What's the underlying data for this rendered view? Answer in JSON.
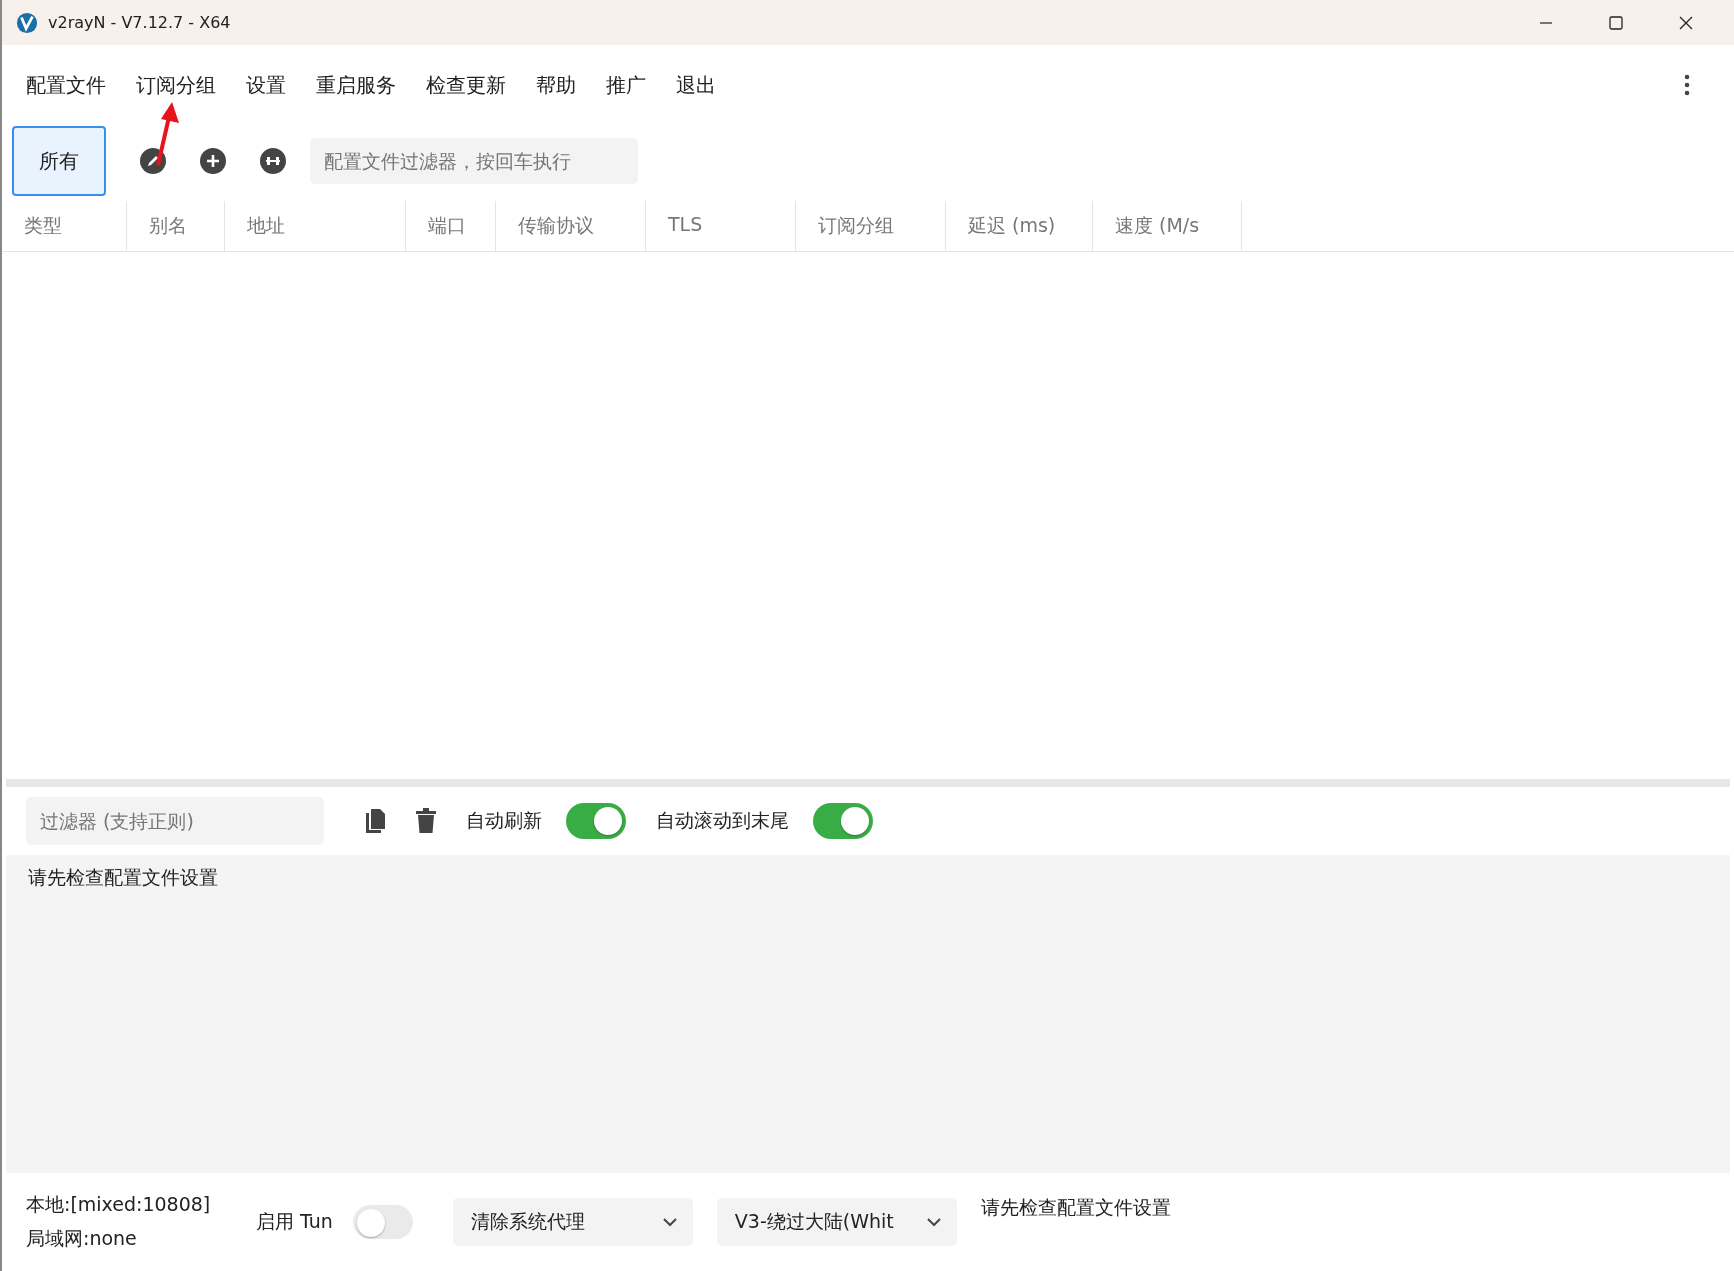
{
  "window": {
    "title": "v2rayN - V7.12.7 - X64"
  },
  "menu": [
    "配置文件",
    "订阅分组",
    "设置",
    "重启服务",
    "检查更新",
    "帮助",
    "推广",
    "退出"
  ],
  "groups": [
    {
      "label": "所有",
      "selected": true
    }
  ],
  "profile_filter": {
    "placeholder": "配置文件过滤器，按回车执行"
  },
  "table": {
    "columns": [
      "类型",
      "别名",
      "地址",
      "端口",
      "传输协议",
      "TLS",
      "订阅分组",
      "延迟 (ms)",
      "速度 (M/s"
    ]
  },
  "log_toolbar": {
    "filter": {
      "placeholder": "过滤器 (支持正则)"
    },
    "toggles": [
      {
        "label": "自动刷新",
        "on": true
      },
      {
        "label": "自动滚动到末尾",
        "on": true
      }
    ]
  },
  "log": {
    "lines": [
      "请先检查配置文件设置"
    ]
  },
  "status_bar": {
    "local": "本地:[mixed:10808]",
    "lan": "局域网:none",
    "tun": {
      "label": "启用 Tun",
      "on": false
    },
    "selects": [
      {
        "value": "清除系统代理"
      },
      {
        "value": "V3-绕过大陆(Whit"
      }
    ],
    "message": "请先检查配置文件设置"
  }
}
